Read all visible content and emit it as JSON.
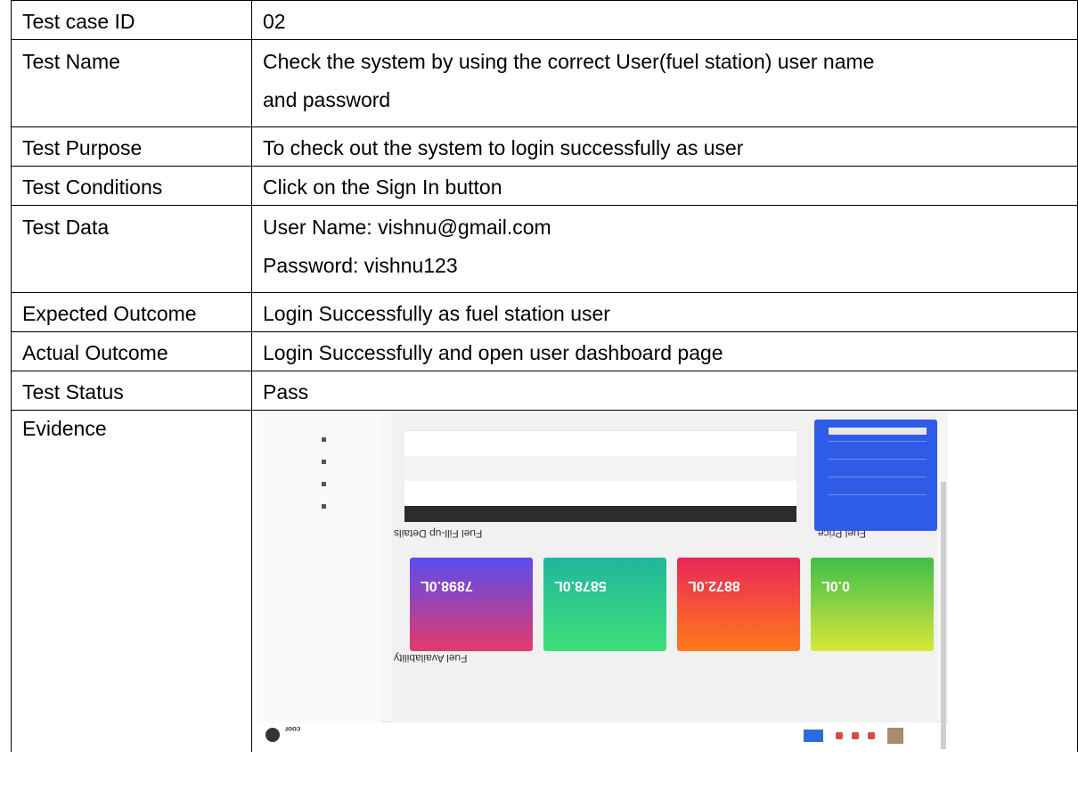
{
  "rows": [
    {
      "label": "Test case ID",
      "value": "02"
    },
    {
      "label": "Test Name",
      "value_lines": [
        "Check the system by using the correct User(fuel station) user name",
        "and password"
      ]
    },
    {
      "label": "Test Purpose",
      "value": "To check out the system to login successfully as user"
    },
    {
      "label": "Test Conditions",
      "value": "Click on the Sign In button"
    },
    {
      "label": "Test Data",
      "value_lines": [
        "User Name: vishnu@gmail.com",
        "Password: vishnu123"
      ]
    },
    {
      "label": "Expected Outcome",
      "value": "Login Successfully as fuel station user"
    },
    {
      "label": "Actual Outcome",
      "value": "Login Successfully and open user dashboard page"
    },
    {
      "label": "Test Status",
      "value": "Pass"
    },
    {
      "label": "Evidence"
    }
  ],
  "evidence": {
    "logo_text": "coor",
    "section_availability": "Fuel Availability",
    "section_fillup": "Fuel Fill-up Details",
    "section_price": "Fuel Price",
    "cards": [
      {
        "value": "7898.0L",
        "color_from": "#5a4cf0",
        "color_to": "#e33a6a"
      },
      {
        "value": "5878.0L",
        "color_from": "#1fb79a",
        "color_to": "#3ee07a"
      },
      {
        "value": "8872.0L",
        "color_from": "#e8275a",
        "color_to": "#ff7a1a"
      },
      {
        "value": "0.0L",
        "color_from": "#3dbf4a",
        "color_to": "#d9e63a"
      }
    ],
    "accent": "#2f5ce6"
  }
}
